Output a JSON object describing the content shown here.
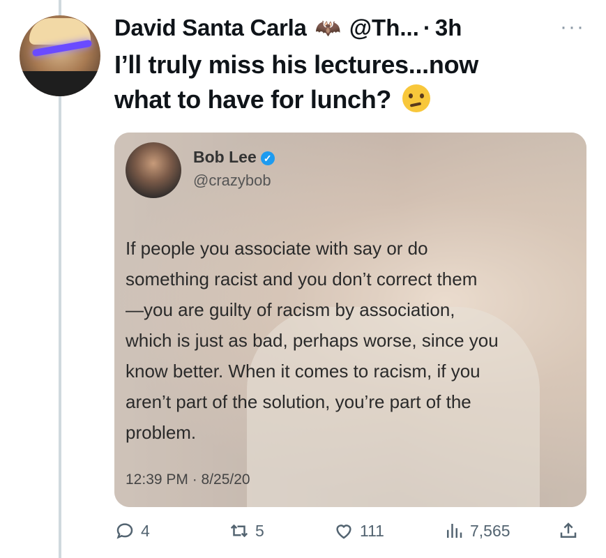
{
  "tweet": {
    "display_name": "David Santa Carla",
    "name_emoji": "🦇",
    "handle": "@Th...",
    "separator": "·",
    "time": "3h",
    "more": "···",
    "text_line1": "I’ll truly miss his lectures...now",
    "text_line2": "what to have for lunch?",
    "emoji_icon": "thinking-face-icon"
  },
  "embedded": {
    "name": "Bob Lee",
    "verified_icon": "verified-badge-icon",
    "handle": "@crazybob",
    "lines": [
      "If people you associate with say or do",
      "something racist and you don’t correct them",
      "—you are guilty of racism by association,",
      "which is just as bad, perhaps worse, since you",
      "know better. When it comes to racism, if you",
      "aren’t part of the solution, you’re part of the",
      "problem."
    ],
    "timestamp": "12:39 PM · 8/25/20"
  },
  "actions": {
    "replies": "4",
    "retweets": "5",
    "likes": "111",
    "views": "7,565"
  },
  "colors": {
    "accent": "#1d9bf0",
    "muted": "#536471",
    "thread_line": "#cfd9de"
  }
}
